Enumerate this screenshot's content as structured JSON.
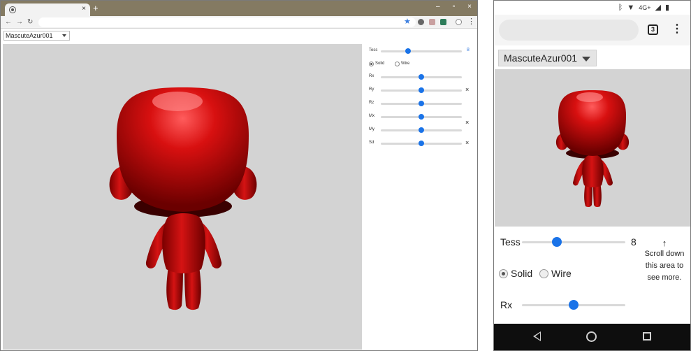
{
  "desktop": {
    "tab": {
      "close": "×",
      "new_tab": "+"
    },
    "window_controls": {
      "minimize": "–",
      "maximize": "▫",
      "close": "×"
    },
    "nav": {
      "back": "←",
      "forward": "→",
      "reload": "↻"
    },
    "bookmark_icon": "★",
    "menu_icon": "⋮",
    "model_select": {
      "selected": "MascuteAzur001"
    },
    "controls": {
      "tess": {
        "label": "Tess",
        "value": "8",
        "fraction": 0.34
      },
      "radio": [
        {
          "label": "Solid",
          "selected": true
        },
        {
          "label": "Wire",
          "selected": false
        }
      ],
      "sliders": [
        {
          "label": "Rx",
          "fraction": 0.5,
          "reset": ""
        },
        {
          "label": "Ry",
          "fraction": 0.5,
          "reset": "×"
        },
        {
          "label": "Rz",
          "fraction": 0.5,
          "reset": ""
        },
        {
          "label": "Mx",
          "fraction": 0.5,
          "reset": ""
        },
        {
          "label": "My",
          "fraction": 0.5,
          "reset": ""
        },
        {
          "label": "Sd",
          "fraction": 0.5,
          "reset": "×"
        }
      ],
      "extra_reset": "×"
    }
  },
  "phone": {
    "status": {
      "network": "4G+"
    },
    "tab_count": "3",
    "menu_icon": "⋮",
    "model_select": {
      "selected": "MascuteAzur001"
    },
    "tess": {
      "label": "Tess",
      "value": "8",
      "fraction": 0.34
    },
    "radio": [
      {
        "label": "Solid",
        "selected": true
      },
      {
        "label": "Wire",
        "selected": false
      }
    ],
    "rx": {
      "label": "Rx",
      "fraction": 0.5
    },
    "hint": {
      "arrow": "↑",
      "text": "Scroll down this area to see more."
    }
  },
  "colors": {
    "model": "#c00000",
    "viewport": "#d3d3d3",
    "accent": "#1a73e8"
  }
}
